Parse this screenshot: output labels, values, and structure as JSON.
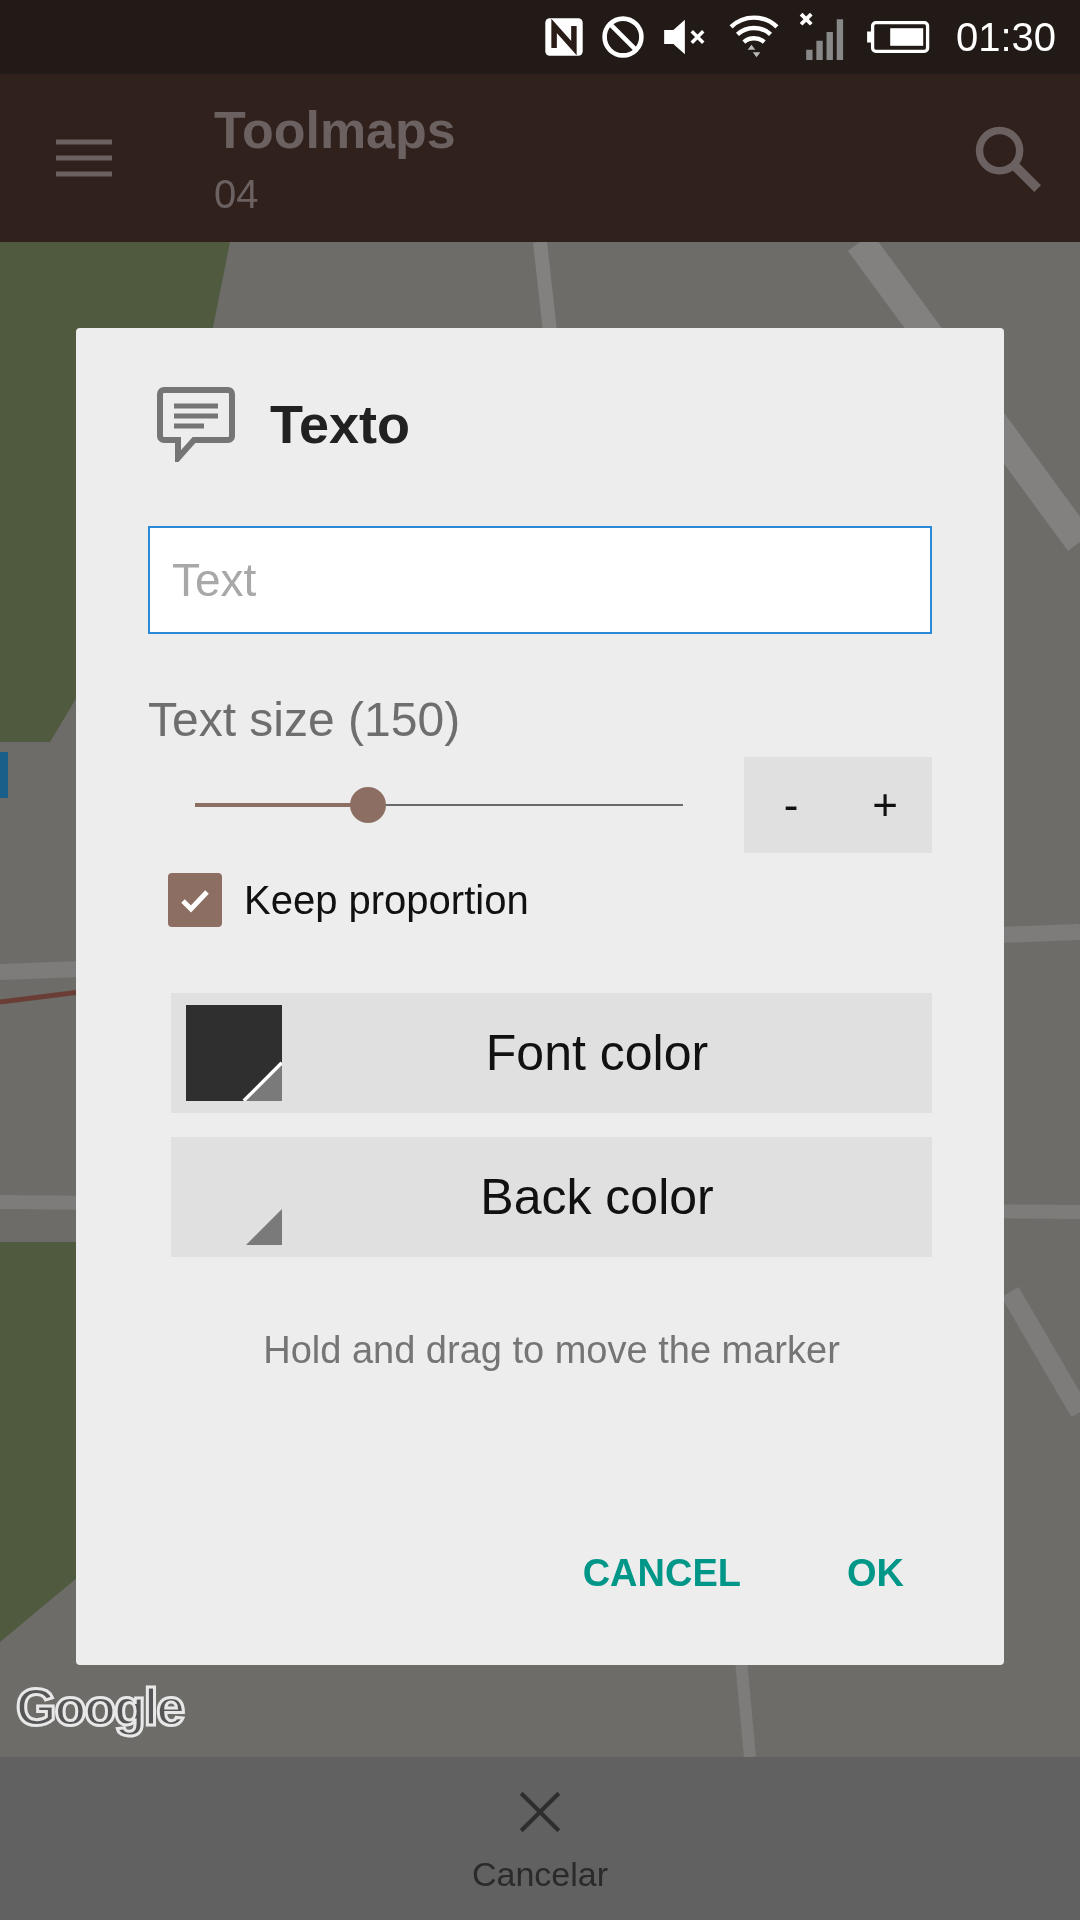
{
  "status_bar": {
    "time": "01:30"
  },
  "app_bar": {
    "title": "Toolmaps",
    "subtitle": "04"
  },
  "map": {
    "kind": "picture",
    "attribution": "Google"
  },
  "dialog": {
    "title": "Texto",
    "text_field": {
      "placeholder": "Text"
    },
    "size_label": "Text size (150)",
    "size_slider": {
      "level": 0.355
    },
    "stepper": [
      "-",
      "+"
    ],
    "keep_proportion": {
      "label": "Keep proportion",
      "checked": true
    },
    "color_buttons": [
      {
        "label": "Font color",
        "color": "#2f2f2f"
      },
      {
        "label": "Back color"
      }
    ],
    "hint": "Hold and drag to move the marker",
    "actions": [
      "CANCEL",
      "OK"
    ]
  },
  "bottom_bar": {
    "cancel_label": "Cancelar"
  }
}
